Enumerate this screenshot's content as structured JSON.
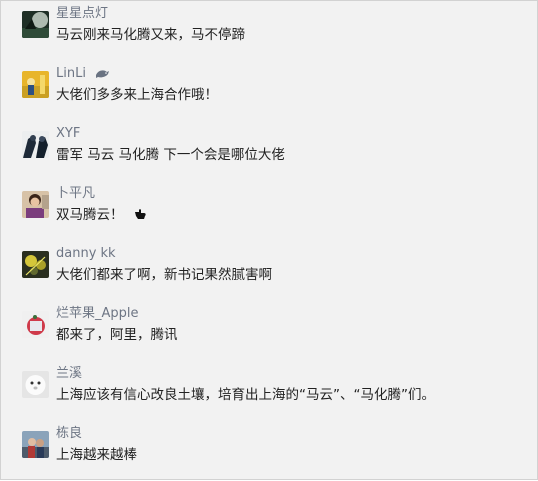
{
  "comments": [
    {
      "name": "星星点灯",
      "text": "马云刚来马化腾又来，马不停蹄"
    },
    {
      "name": "LinLi",
      "name_icon": "dolphin-icon",
      "text": "大佬们多多来上海合作哦！"
    },
    {
      "name": "XYF",
      "text": "雷军 马云 马化腾 下一个会是哪位大佬"
    },
    {
      "name": "卜平凡",
      "text": "双马腾云！",
      "text_icon": "pointing-hand-icon"
    },
    {
      "name": "danny kk",
      "text": "大佬们都来了啊，新书记果然腻害啊"
    },
    {
      "name": "烂苹果_Apple",
      "text": "都来了，阿里，腾讯"
    },
    {
      "name": "兰溪",
      "text": "上海应该有信心改良土壤，培育出上海的“马云”、“马化腾”们。"
    },
    {
      "name": "栋良",
      "text": "上海越来越棒"
    }
  ],
  "colors": {
    "background": "#f2f2f2",
    "name": "#6d7584",
    "text": "#222222",
    "border": "#d2d2d2"
  }
}
